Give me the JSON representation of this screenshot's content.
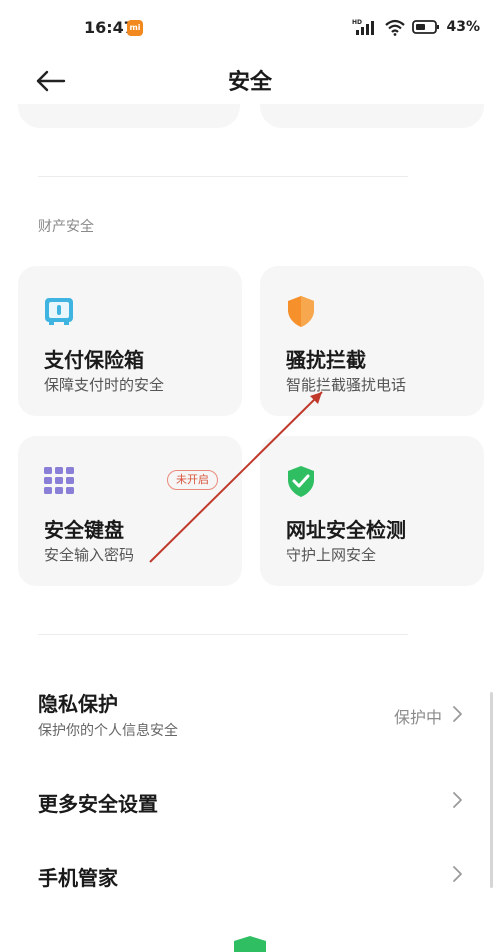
{
  "status_bar": {
    "time": "16:47",
    "brand_badge": "mi",
    "network": "HD",
    "battery": "43%"
  },
  "app_bar": {
    "title": "安全",
    "back_icon": "arrow-left-icon"
  },
  "section": {
    "title": "财产安全"
  },
  "cards": [
    {
      "title": "支付保险箱",
      "subtitle": "保障支付时的安全",
      "icon": "safe-box-icon"
    },
    {
      "title": "骚扰拦截",
      "subtitle": "智能拦截骚扰电话",
      "icon": "shield-orange-icon"
    },
    {
      "title": "安全键盘",
      "subtitle": "安全输入密码",
      "icon": "keypad-icon",
      "badge": "未开启"
    },
    {
      "title": "网址安全检测",
      "subtitle": "守护上网安全",
      "icon": "shield-check-icon"
    }
  ],
  "rows": [
    {
      "title": "隐私保护",
      "subtitle": "保护你的个人信息安全",
      "value": "保护中"
    },
    {
      "title": "更多安全设置"
    },
    {
      "title": "手机管家"
    }
  ],
  "colors": {
    "accent_orange": "#f5902a",
    "accent_green": "#2fbf62",
    "badge_red": "#d9553d",
    "icon_teal": "#3fb4e0",
    "icon_purple": "#8a7fd6",
    "annotation_red": "#c0392b"
  }
}
